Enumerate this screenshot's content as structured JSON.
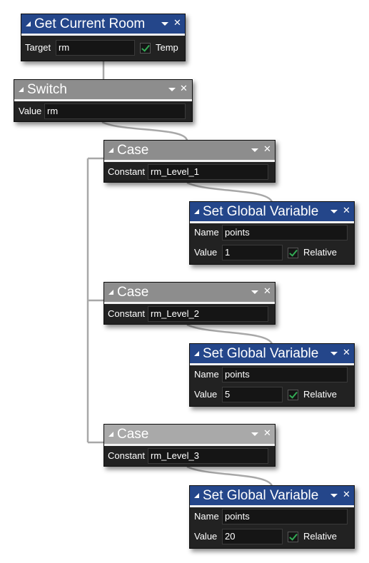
{
  "nodes": {
    "get_current_room": {
      "title": "Get Current Room",
      "target_label": "Target",
      "target_value": "rm",
      "temp_label": "Temp",
      "temp_checked": true
    },
    "switch": {
      "title": "Switch",
      "value_label": "Value",
      "value": "rm"
    },
    "case1": {
      "title": "Case",
      "constant_label": "Constant",
      "constant_value": "rm_Level_1"
    },
    "set1": {
      "title": "Set Global Variable",
      "name_label": "Name",
      "name_value": "points",
      "value_label": "Value",
      "value": "1",
      "relative_label": "Relative",
      "relative_checked": true
    },
    "case2": {
      "title": "Case",
      "constant_label": "Constant",
      "constant_value": "rm_Level_2"
    },
    "set2": {
      "title": "Set Global Variable",
      "name_label": "Name",
      "name_value": "points",
      "value_label": "Value",
      "value": "5",
      "relative_label": "Relative",
      "relative_checked": true
    },
    "case3": {
      "title": "Case",
      "constant_label": "Constant",
      "constant_value": "rm_Level_3"
    },
    "set3": {
      "title": "Set Global Variable",
      "name_label": "Name",
      "name_value": "points",
      "value_label": "Value",
      "value": "20",
      "relative_label": "Relative",
      "relative_checked": true
    }
  },
  "icons": {
    "collapse": "collapse-triangle-icon",
    "menu": "dropdown-arrow-icon",
    "close": "close-icon",
    "checkbox": "checkmark-icon"
  },
  "colors": {
    "action_header": "#24468a",
    "switch_header": "#8d8d8d",
    "case_header": "#8d8d8d",
    "case_header_inactive": "#a9a9a9",
    "node_body": "#222222",
    "check": "#33aa55",
    "wire": "#a8a8a8"
  }
}
